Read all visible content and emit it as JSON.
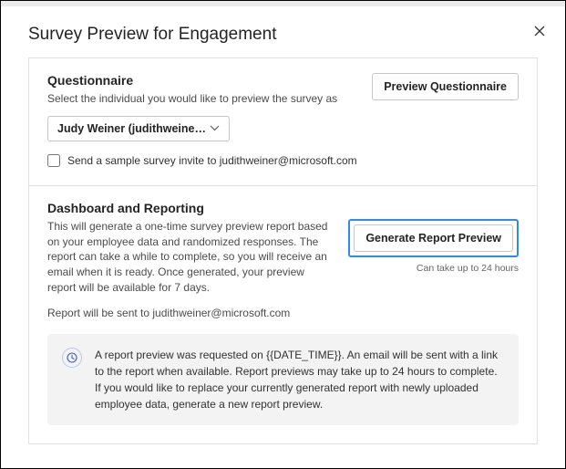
{
  "dialog": {
    "title": "Survey Preview for Engagement"
  },
  "questionnaire": {
    "title": "Questionnaire",
    "subtitle": "Select the individual you would like to preview the survey as",
    "preview_button": "Preview Questionnaire",
    "selected_person": "Judy Weiner (judithweiner…",
    "checkbox_label": "Send a sample survey invite to judithweiner@microsoft.com"
  },
  "dashboard": {
    "title": "Dashboard and Reporting",
    "description": "This will generate a one-time survey preview report based on your employee data and randomized responses. The report can take a while to complete, so you will receive an email when it is ready. Once generated, your preview report will be available for 7 days.",
    "generate_button": "Generate Report Preview",
    "timing_note": "Can take up to 24 hours",
    "sent_to": "Report will be sent to judithweiner@microsoft.com",
    "info_message": "A report preview was requested on {{DATE_TIME}}. An email will be sent with a link to the report when available. Report previews may take up to 24 hours to complete. If you would like to replace your currently generated report with newly uploaded employee data, generate a new report preview."
  }
}
